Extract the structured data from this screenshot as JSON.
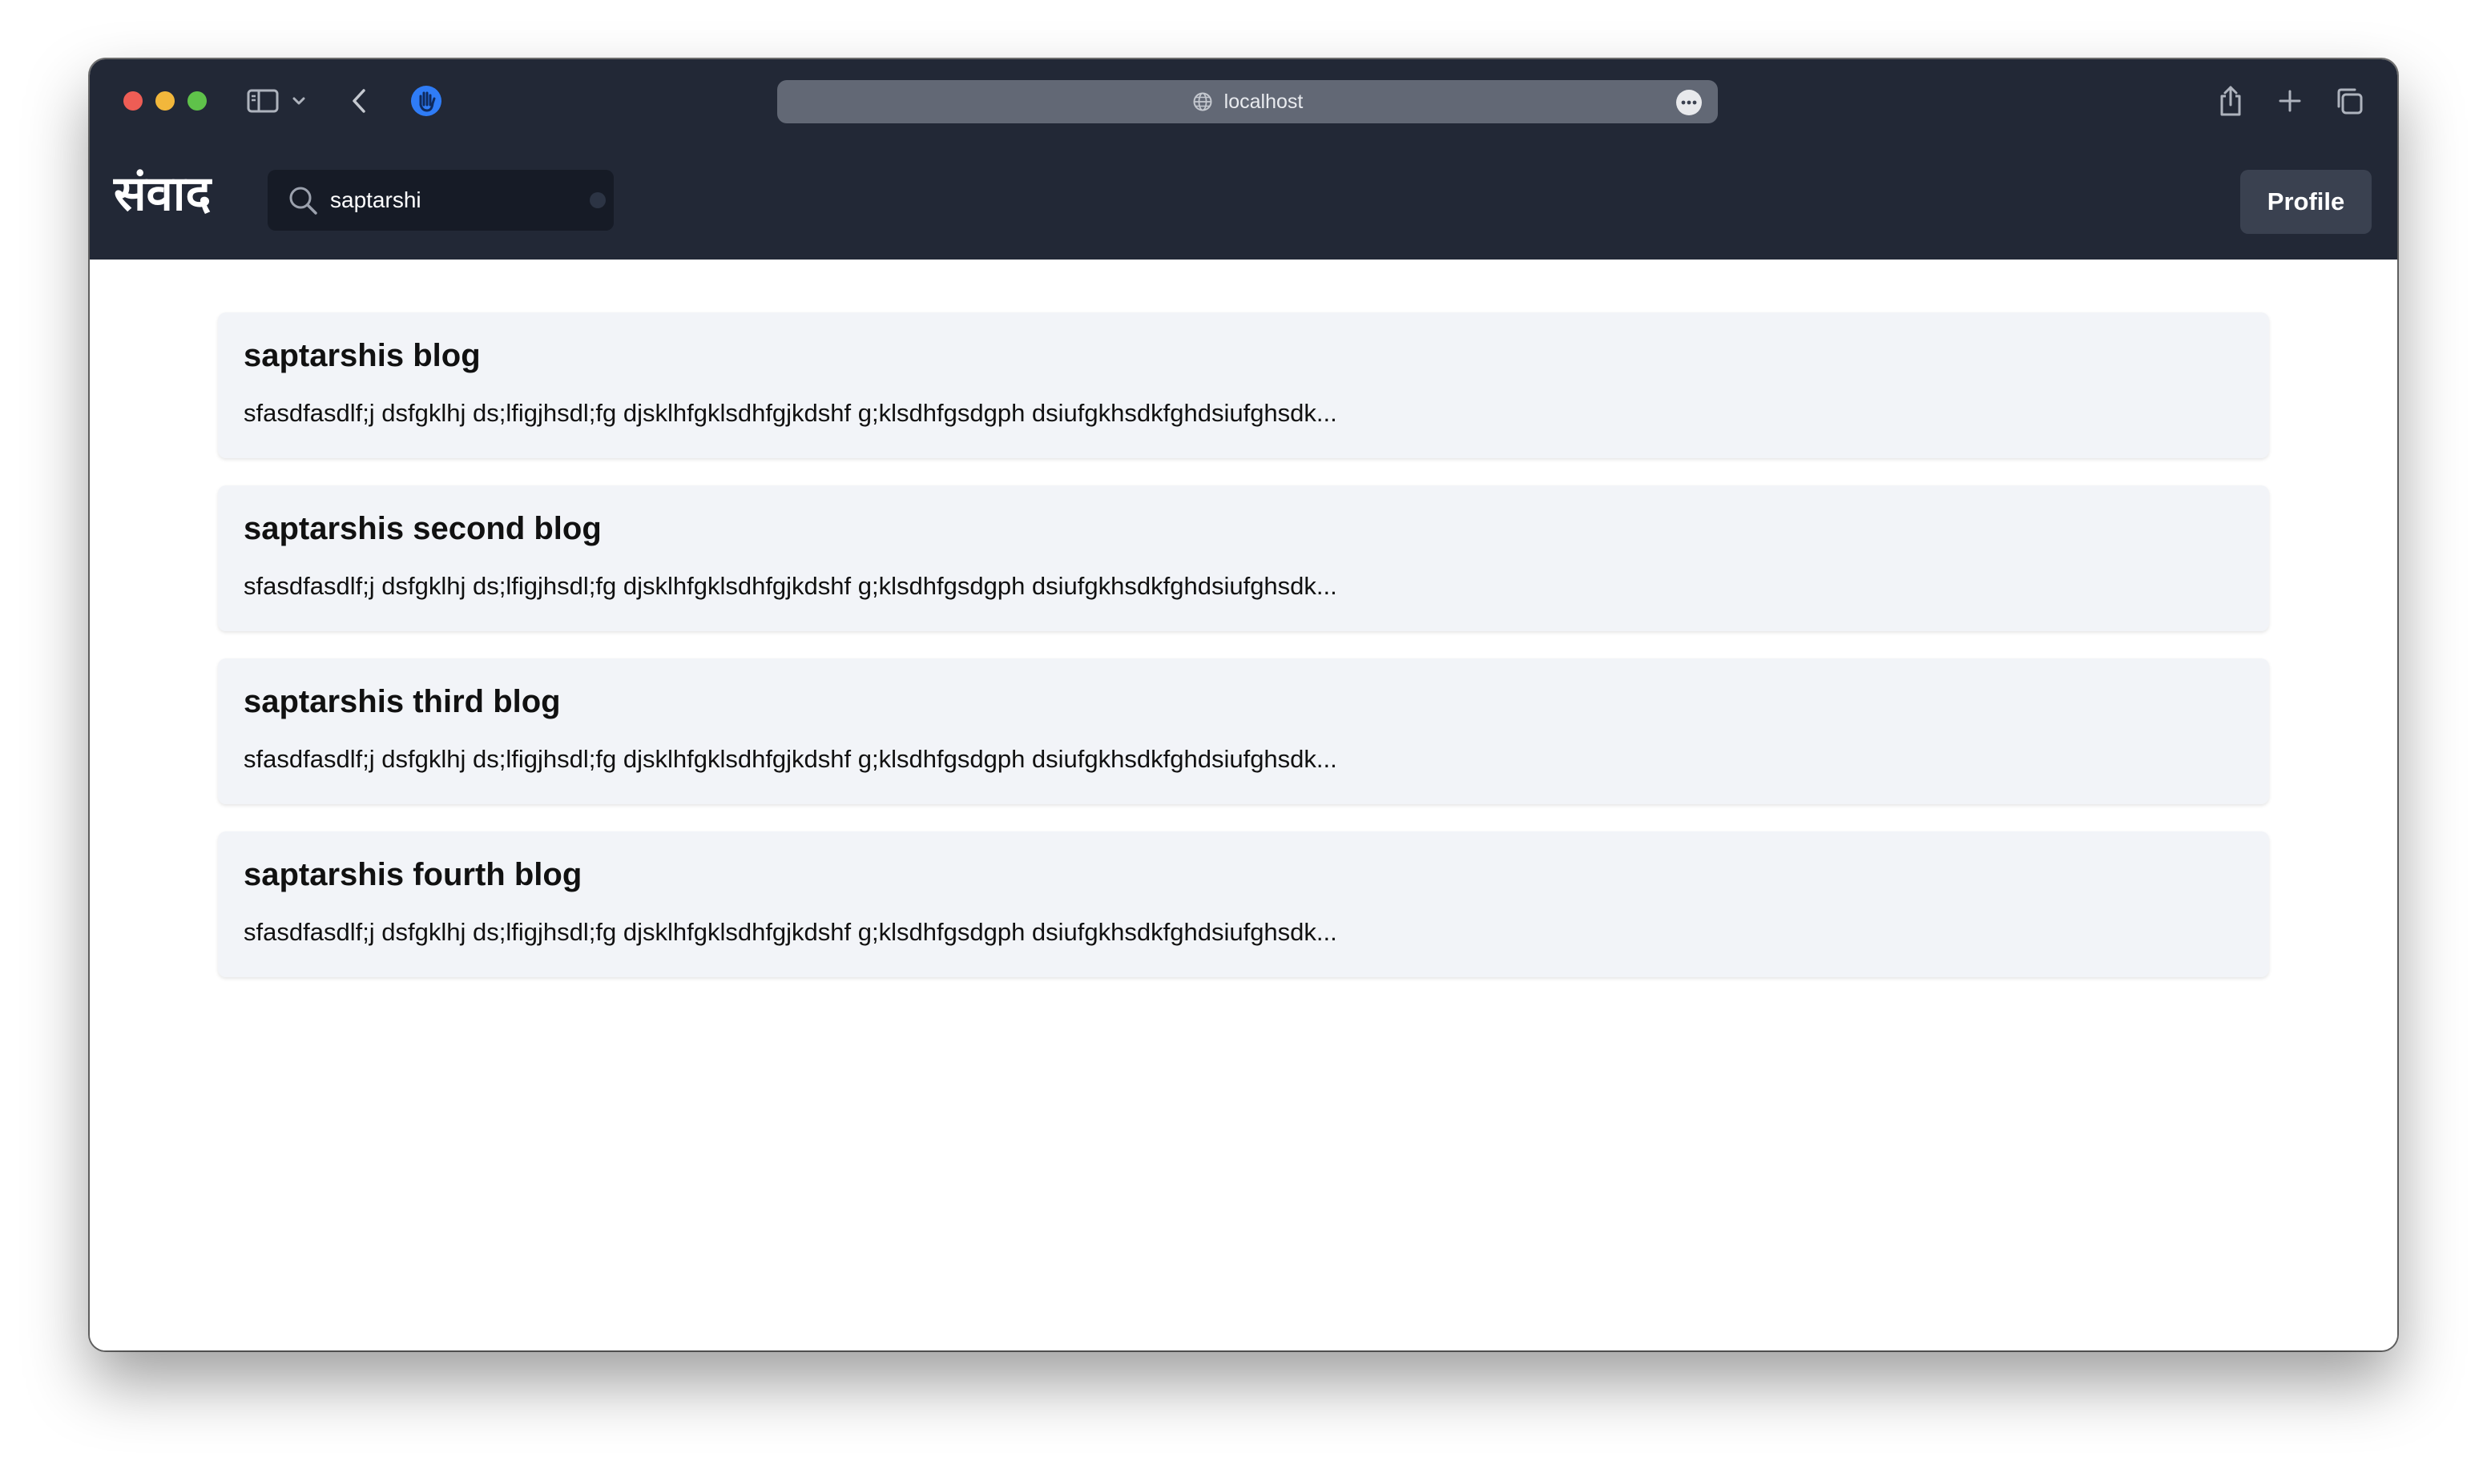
{
  "browser": {
    "url": "localhost",
    "icons": {
      "sidebar": "sidebar-icon",
      "chevron": "chevron-down-icon",
      "back": "chevron-left-icon",
      "privacy": "shield-hand-icon",
      "globe": "globe-icon",
      "more": "ellipsis-icon",
      "share": "share-icon",
      "new_tab": "plus-icon",
      "tabs": "tabs-overview-icon"
    }
  },
  "navbar": {
    "brand": "संवाद",
    "search": {
      "value": "saptarshi",
      "placeholder": ""
    },
    "profile_label": "Profile"
  },
  "blogs": [
    {
      "title": "saptarshis blog",
      "excerpt": "sfasdfasdlf;j dsfgklhj ds;lfigjhsdl;fg djsklhfgklsdhfgjkdshf g;klsdhfgsdgph dsiufgkhsdkfghdsiufghsdk..."
    },
    {
      "title": "saptarshis second blog",
      "excerpt": "sfasdfasdlf;j dsfgklhj ds;lfigjhsdl;fg djsklhfgklsdhfgjkdshf g;klsdhfgsdgph dsiufgkhsdkfghdsiufghsdk..."
    },
    {
      "title": "saptarshis third blog",
      "excerpt": "sfasdfasdlf;j dsfgklhj ds;lfigjhsdl;fg djsklhfgklsdhfgjkdshf g;klsdhfgsdgph dsiufgkhsdkfghdsiufghsdk..."
    },
    {
      "title": "saptarshis fourth blog",
      "excerpt": "sfasdfasdlf;j dsfgklhj ds;lfigjhsdl;fg djsklhfgklsdhfgjkdshf g;klsdhfgsdgph dsiufgkhsdkfghdsiufghsdk..."
    }
  ],
  "colors": {
    "navbar_bg": "#222836",
    "search_bg": "#161b26",
    "profile_bg": "#3a4150",
    "card_bg": "#f2f4f8",
    "privacy_accent": "#2f7cf6"
  }
}
